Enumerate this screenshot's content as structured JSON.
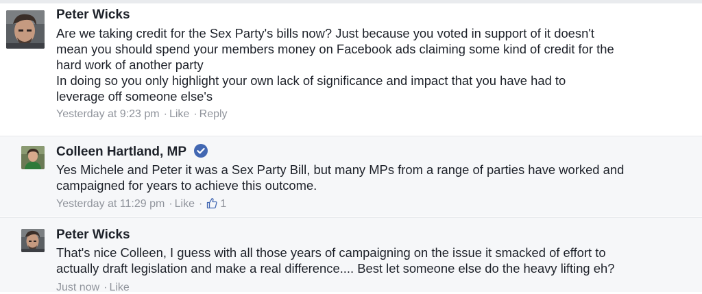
{
  "comments": [
    {
      "author": "Peter Wicks",
      "body_lines": [
        "Are we taking credit for the Sex Party's bills now? Just because you voted in support of it doesn't",
        "mean you should spend your members money on Facebook ads claiming some kind of credit for the",
        "hard work of another party",
        "In doing so you only highlight your own lack of significance and impact that you have had to",
        "leverage off someone else's"
      ],
      "timestamp": "Yesterday at 9:23 pm",
      "like_label": "Like",
      "reply_label": "Reply"
    },
    {
      "author": "Colleen Hartland, MP",
      "verified": true,
      "body_lines": [
        "Yes Michele and Peter it was a Sex Party Bill, but many MPs from a range of parties have worked and",
        "campaigned for years to achieve this outcome."
      ],
      "timestamp": "Yesterday at 11:29 pm",
      "like_label": "Like",
      "like_count": "1"
    },
    {
      "author": "Peter Wicks",
      "body_lines": [
        "That's nice Colleen, I guess with all those years of campaigning on the issue it smacked of effort to",
        "actually draft legislation and make a real difference.... Best let someone else do the heavy lifting eh?"
      ],
      "timestamp": "Just now",
      "like_label": "Like"
    }
  ],
  "separator": "·",
  "colors": {
    "verified_badge": "#4267b2",
    "meta_text": "#90949c",
    "highlight_bg": "#f6f7f9"
  }
}
